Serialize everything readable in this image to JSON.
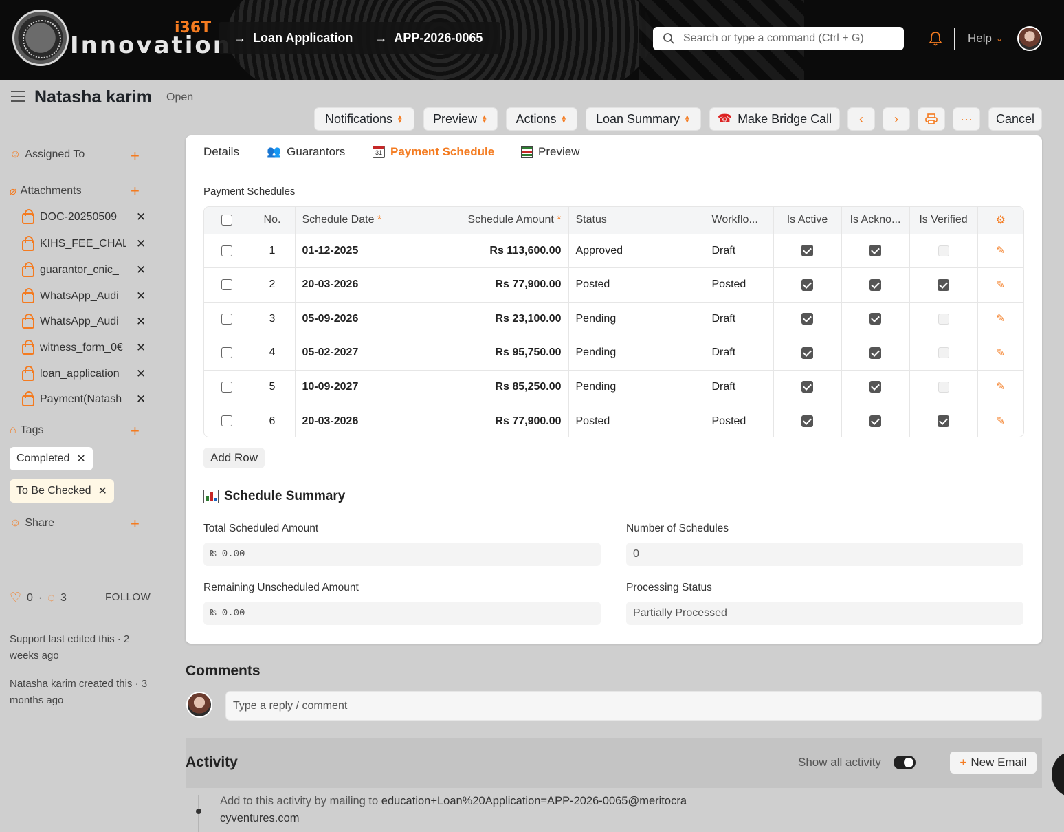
{
  "app": {
    "logo_text": "Innovation",
    "logo_sup": "i36T",
    "breadcrumbs": [
      "Loan Application",
      "APP-2026-0065"
    ],
    "search_placeholder": "Search or type a command (Ctrl + G)",
    "help_label": "Help"
  },
  "header": {
    "title": "Natasha karim",
    "status": "Open",
    "buttons": {
      "notifications": "Notifications",
      "preview": "Preview",
      "actions": "Actions",
      "loan_summary": "Loan Summary",
      "bridge_call": "Make Bridge Call",
      "cancel": "Cancel"
    }
  },
  "sidebar": {
    "assigned_to": "Assigned To",
    "attachments_label": "Attachments",
    "attachments": [
      "DOC-20250509",
      "KIHS_FEE_CHAL",
      "guarantor_cnic_",
      "WhatsApp_Audi",
      "WhatsApp_Audi",
      "witness_form_0€",
      "loan_application",
      "Payment(Natash"
    ],
    "tags_label": "Tags",
    "tags": [
      "Completed",
      "To Be Checked"
    ],
    "share_label": "Share",
    "likes": "0",
    "comments_count": "3",
    "follow": "FOLLOW",
    "edited_note": "Support last edited this · 2 weeks ago",
    "created_note": "Natasha karim created this · 3 months ago"
  },
  "tabs": {
    "details": "Details",
    "guarantors": "Guarantors",
    "payment_schedule": "Payment Schedule",
    "preview": "Preview"
  },
  "schedules": {
    "section_label": "Payment Schedules",
    "columns": [
      "No.",
      "Schedule Date",
      "Schedule Amount",
      "Status",
      "Workflo...",
      "Is Active",
      "Is Ackno...",
      "Is Verified"
    ],
    "rows": [
      {
        "no": "1",
        "date": "01-12-2025",
        "amount": "Rs 113,600.00",
        "status": "Approved",
        "workflow": "Draft",
        "active": true,
        "ack": true,
        "verified": false
      },
      {
        "no": "2",
        "date": "20-03-2026",
        "amount": "Rs 77,900.00",
        "status": "Posted",
        "workflow": "Posted",
        "active": true,
        "ack": true,
        "verified": true
      },
      {
        "no": "3",
        "date": "05-09-2026",
        "amount": "Rs 23,100.00",
        "status": "Pending",
        "workflow": "Draft",
        "active": true,
        "ack": true,
        "verified": false
      },
      {
        "no": "4",
        "date": "05-02-2027",
        "amount": "Rs 95,750.00",
        "status": "Pending",
        "workflow": "Draft",
        "active": true,
        "ack": true,
        "verified": false
      },
      {
        "no": "5",
        "date": "10-09-2027",
        "amount": "Rs 85,250.00",
        "status": "Pending",
        "workflow": "Draft",
        "active": true,
        "ack": true,
        "verified": false
      },
      {
        "no": "6",
        "date": "20-03-2026",
        "amount": "Rs 77,900.00",
        "status": "Posted",
        "workflow": "Posted",
        "active": true,
        "ack": true,
        "verified": true
      }
    ],
    "add_row": "Add Row"
  },
  "summary": {
    "title": "Schedule Summary",
    "total_label": "Total Scheduled Amount",
    "total_value": "₨ 0.00",
    "count_label": "Number of Schedules",
    "count_value": "0",
    "remaining_label": "Remaining Unscheduled Amount",
    "remaining_value": "₨ 0.00",
    "processing_label": "Processing Status",
    "processing_value": "Partially Processed"
  },
  "comments": {
    "title": "Comments",
    "placeholder": "Type a reply / comment"
  },
  "activity": {
    "title": "Activity",
    "show_all": "Show all activity",
    "new_email": "New Email",
    "mail_prefix": "Add to this activity by mailing to",
    "mail_address": "education+Loan%20Application=APP-2026-0065@meritocracyventures.com"
  },
  "colors": {
    "accent": "#f47b20",
    "topbar": "#0b0b0b"
  }
}
